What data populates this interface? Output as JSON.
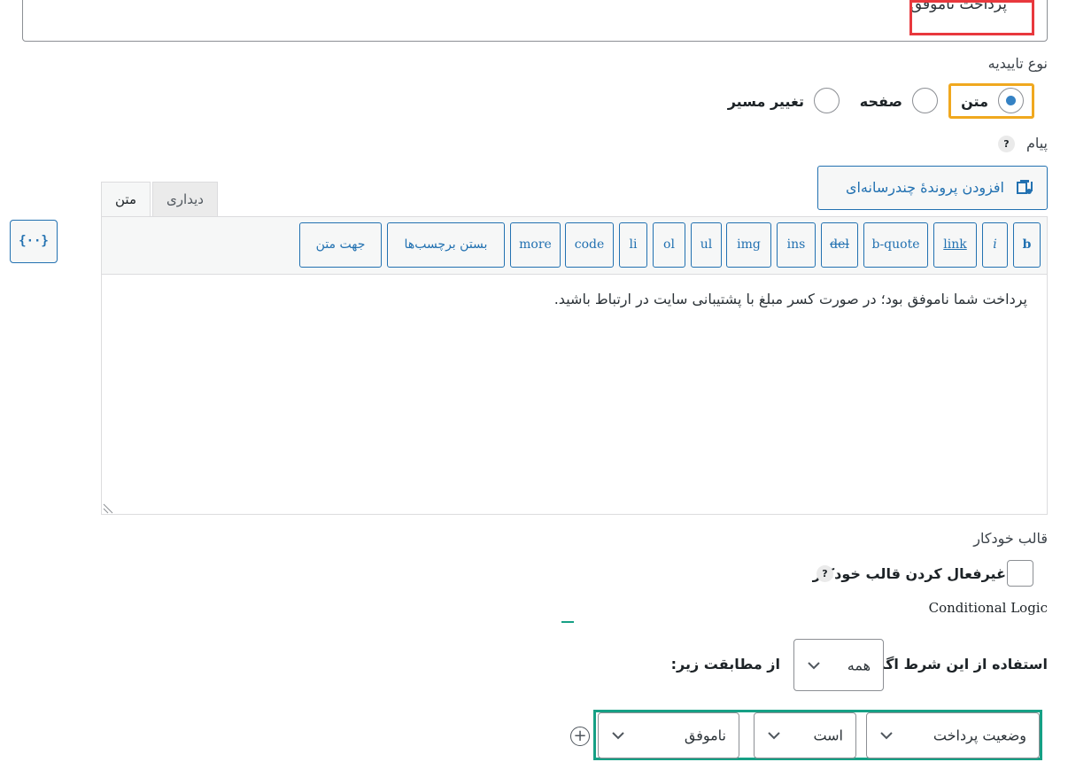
{
  "title_field": {
    "value": "پرداخت ناموفق"
  },
  "confirmation": {
    "label": "نوع تاییدیه",
    "options": [
      "متن",
      "صفحه",
      "تغییر مسیر"
    ],
    "selected": "متن"
  },
  "message": {
    "label": "پیام",
    "help_icon": "?",
    "add_media_label": "افزودن پروندهٔ چندرسانه‌ای",
    "tabs": [
      "دیداری",
      "متن"
    ],
    "active_tab": "متن",
    "merge_tags_icon": "{··}",
    "toolbar_buttons": [
      "b",
      "i",
      "link",
      "b-quote",
      "del",
      "ins",
      "img",
      "ul",
      "ol",
      "li",
      "code",
      "more",
      "بستن برچسب‌ها",
      "جهت متن"
    ],
    "content": "پرداخت شما ناموفق بود؛ در صورت کسر مبلغ با پشتیبانی سایت در ارتباط باشید."
  },
  "autoformat": {
    "label": "قالب خودکار",
    "checkbox_label": "غیرفعال کردن قالب خودکار",
    "checked": false,
    "help_icon": "?"
  },
  "conditional_logic": {
    "title": "Conditional Logic",
    "prefix": "استفاده از این شرط اگر",
    "match_value": "همه",
    "suffix": "از مطابقت زیر:",
    "rule": {
      "field": "وضعیت پرداخت",
      "operator": "است",
      "value": "ناموفق"
    },
    "add_icon": "+"
  },
  "colors": {
    "accent": "#2271b1",
    "title_highlight": "#e8383d",
    "radio_highlight": "#f0a81f",
    "rule_highlight": "#16a085"
  }
}
